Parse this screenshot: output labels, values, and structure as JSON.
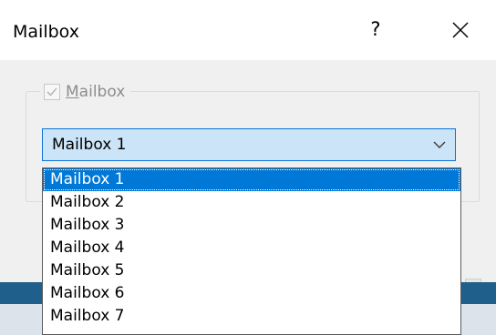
{
  "window": {
    "title": "Mailbox",
    "help_icon": "?",
    "close_icon": "close-icon"
  },
  "group": {
    "checkbox_checked": true,
    "label_prefix": "",
    "label_mnemonic": "M",
    "label_rest": "ailbox"
  },
  "combo": {
    "selected_value": "Mailbox 1",
    "icon": "chevron-down-icon"
  },
  "dropdown": {
    "options": [
      "Mailbox 1",
      "Mailbox 2",
      "Mailbox 3",
      "Mailbox 4",
      "Mailbox 5",
      "Mailbox 6",
      "Mailbox 7"
    ],
    "highlighted_index": 0
  },
  "colors": {
    "accent": "#0078d7",
    "combo_bg": "#cce4f7",
    "dialog_bg": "#f0f0f0"
  }
}
